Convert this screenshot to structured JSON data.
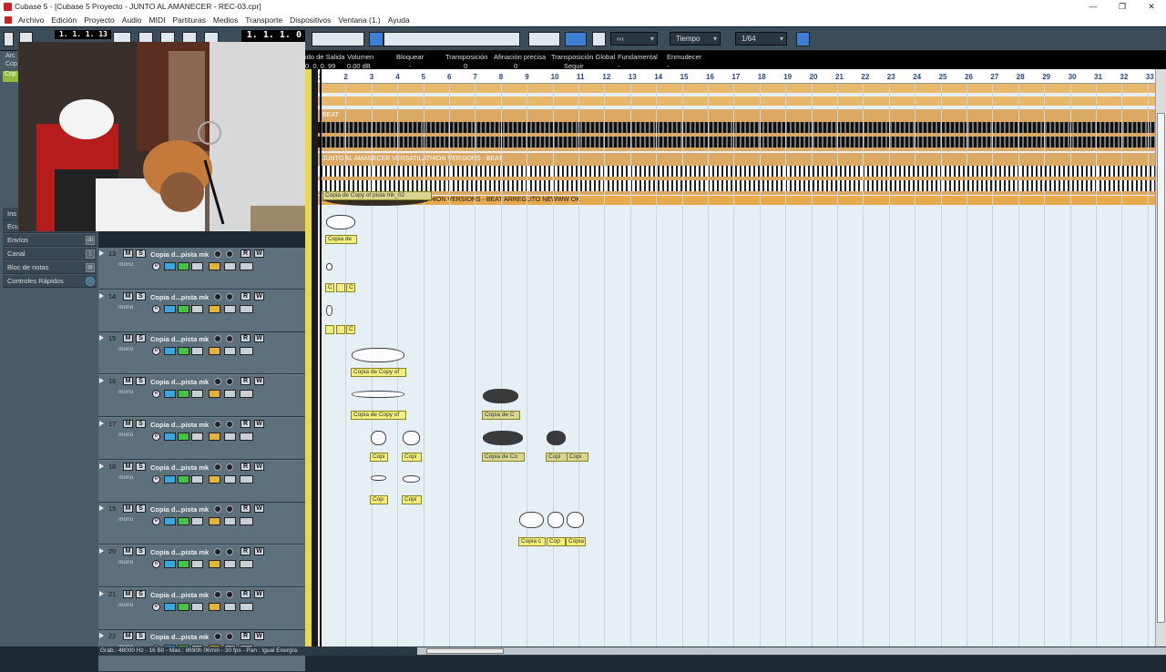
{
  "window": {
    "title": "Cubase 5 - [Cubase 5 Proyecto - JUNTO AL AMANECER - REC-03.cpr]",
    "controls": {
      "minimize": "—",
      "restore": "❐",
      "close": "✕"
    }
  },
  "menu": [
    "Archivo",
    "Edición",
    "Proyecto",
    "Audio",
    "MIDI",
    "Partituras",
    "Medios",
    "Transporte",
    "Dispositivos",
    "Ventana (1.)",
    "Ayuda"
  ],
  "toolbar": {
    "position_primary": "1. 1. 1. 13",
    "position_secondary": "1. 1. 1. 0",
    "snap_type": "Tiempo",
    "quantize": "1/64",
    "grid_label": "‹‹‹"
  },
  "infoline": {
    "fields": [
      {
        "label": "ido de Salida",
        "value": "0. 0. 0. 99"
      },
      {
        "label": "Volumen",
        "value": "0.00 dB"
      },
      {
        "label": "Bloquear",
        "value": "-"
      },
      {
        "label": "Transposición",
        "value": "0"
      },
      {
        "label": "Afinación precisa",
        "value": "0"
      },
      {
        "label": "Transposición Global",
        "value": "Seguir"
      },
      {
        "label": "Fundamental",
        "value": "-"
      },
      {
        "label": "Enmudecer",
        "value": "-"
      }
    ]
  },
  "inspector": {
    "partial_labels": [
      "Arc",
      "Cop",
      "Cop"
    ],
    "sections": [
      {
        "label": "Ins"
      },
      {
        "label": "Ecu"
      },
      {
        "label": "Envíos",
        "icon": "db"
      },
      {
        "label": "Canal",
        "icon": "▯"
      },
      {
        "label": "Bloc de notas",
        "icon": "▤"
      },
      {
        "label": "Controles Rápidos",
        "icon": "◎"
      }
    ]
  },
  "ruler": {
    "bars": [
      "1",
      "2",
      "3",
      "4",
      "5",
      "6",
      "7",
      "8",
      "9",
      "10",
      "11",
      "12",
      "13",
      "14",
      "15",
      "16",
      "17",
      "18",
      "19",
      "20",
      "21",
      "22",
      "23",
      "24",
      "25",
      "26",
      "27",
      "28",
      "29",
      "30",
      "31",
      "32",
      "33"
    ]
  },
  "arrangement": {
    "lanes": [
      {
        "label": "BEAT"
      },
      {
        "label": "JUNTO AL AMANECER VERSATILATHION VERSIONS - BEAT"
      },
      {
        "label": "JUNTO AL AMANECER VERSATILATHION VERSIONS - BEAT ARREGLITO NEWWW OK"
      }
    ],
    "clips": [
      "Copia de Copy of pista mk_02",
      "Copia de",
      "C",
      "C",
      "C",
      "Copia de Copy of",
      "Copia de Copy of",
      "Copia de C",
      "Copi",
      "Copi",
      "Copia de Co",
      "Copi",
      "Copi",
      "Cop",
      "Copi",
      "Copia c",
      "Cop",
      "Copia"
    ]
  },
  "tracks": [
    {
      "num": "13",
      "name": "Copia d...pista mk",
      "mode": "mono"
    },
    {
      "num": "14",
      "name": "Copia d...pista mk",
      "mode": "mono"
    },
    {
      "num": "15",
      "name": "Copia d...pista mk",
      "mode": "mono"
    },
    {
      "num": "16",
      "name": "Copia d...pista mk",
      "mode": "mono"
    },
    {
      "num": "17",
      "name": "Copia d...pista mk",
      "mode": "mono"
    },
    {
      "num": "18",
      "name": "Copia d...pista mk",
      "mode": "mono"
    },
    {
      "num": "19",
      "name": "Copia d...pista mk",
      "mode": "mono"
    },
    {
      "num": "20",
      "name": "Copia d...pista mk",
      "mode": "mono"
    },
    {
      "num": "21",
      "name": "Copia d...pista mk",
      "mode": "mono"
    },
    {
      "num": "22",
      "name": "Copia d...pista mk",
      "mode": "mono"
    }
  ],
  "track_buttons": {
    "mute": "M",
    "solo": "S",
    "read": "R",
    "write": "W",
    "edit": "e"
  },
  "status": "Grab.: 48000 Hz - 16 Bit - Max.: 8690h 06min - 30 fps - Pan : Igual Energía",
  "colors": {
    "accent": "#3d7fd6",
    "clip": "#f2ee7d",
    "beat": "#e8b86a",
    "background": "#e6eff4"
  }
}
